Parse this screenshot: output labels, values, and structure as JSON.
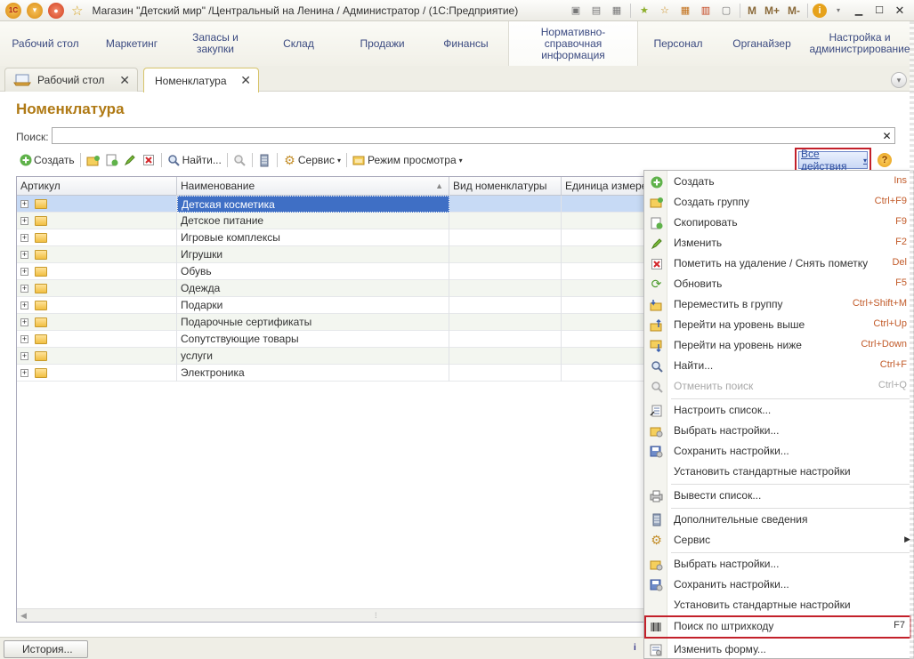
{
  "window": {
    "title": "Магазин \"Детский мир\" /Центральный на Ленина / Администратор /  (1С:Предприятие)",
    "logo_text": "1С",
    "right_buttons": [
      "M",
      "M+",
      "M-"
    ]
  },
  "sections": [
    {
      "label": "Рабочий стол",
      "active": false
    },
    {
      "label": "Маркетинг",
      "active": false
    },
    {
      "label": "Запасы и закупки",
      "active": false
    },
    {
      "label": "Склад",
      "active": false
    },
    {
      "label": "Продажи",
      "active": false
    },
    {
      "label": "Финансы",
      "active": false
    },
    {
      "label": "Нормативно-справочная информация",
      "active": true
    },
    {
      "label": "Персонал",
      "active": false
    },
    {
      "label": "Органайзер",
      "active": false
    },
    {
      "label": "Настройка и администрирование",
      "active": false
    }
  ],
  "tabs": [
    {
      "label": "Рабочий стол",
      "active": false
    },
    {
      "label": "Номенклатура",
      "active": true
    }
  ],
  "form": {
    "title": "Номенклатура",
    "search_label": "Поиск:",
    "search_value": ""
  },
  "toolbar": {
    "create": "Создать",
    "find": "Найти...",
    "service": "Сервис",
    "view_mode": "Режим просмотра",
    "all_actions": "Все действия",
    "help": "?"
  },
  "grid": {
    "columns": [
      "Артикул",
      "Наименование",
      "Вид номенклатуры",
      "Единица измерения"
    ],
    "rows": [
      {
        "name": "Детская косметика",
        "selected": true
      },
      {
        "name": "Детское питание",
        "selected": false
      },
      {
        "name": "Игровые комплексы",
        "selected": false
      },
      {
        "name": "Игрушки",
        "selected": false
      },
      {
        "name": "Обувь",
        "selected": false
      },
      {
        "name": "Одежда",
        "selected": false
      },
      {
        "name": "Подарки",
        "selected": false
      },
      {
        "name": "Подарочные сертификаты",
        "selected": false
      },
      {
        "name": "Сопутствующие товары",
        "selected": false
      },
      {
        "name": "услуги",
        "selected": false
      },
      {
        "name": "Электроника",
        "selected": false
      }
    ]
  },
  "menu": {
    "items": [
      {
        "label": "Создать",
        "shortcut": "Ins",
        "icon": "create-icon"
      },
      {
        "label": "Создать группу",
        "shortcut": "Ctrl+F9",
        "icon": "create-group-icon"
      },
      {
        "label": "Скопировать",
        "shortcut": "F9",
        "icon": "copy-icon"
      },
      {
        "label": "Изменить",
        "shortcut": "F2",
        "icon": "edit-icon"
      },
      {
        "label": "Пометить на удаление / Снять пометку",
        "shortcut": "Del",
        "icon": "delete-mark-icon"
      },
      {
        "label": "Обновить",
        "shortcut": "F5",
        "icon": "refresh-icon"
      },
      {
        "label": "Переместить в группу",
        "shortcut": "Ctrl+Shift+M",
        "icon": "move-to-group-icon"
      },
      {
        "label": "Перейти на уровень выше",
        "shortcut": "Ctrl+Up",
        "icon": "level-up-icon"
      },
      {
        "label": "Перейти на уровень ниже",
        "shortcut": "Ctrl+Down",
        "icon": "level-down-icon"
      },
      {
        "label": "Найти...",
        "shortcut": "Ctrl+F",
        "icon": "find-icon"
      },
      {
        "label": "Отменить поиск",
        "shortcut": "Ctrl+Q",
        "icon": "cancel-search-icon",
        "disabled": true
      },
      {
        "label": "Настроить список...",
        "shortcut": "",
        "icon": "configure-list-icon"
      },
      {
        "label": "Выбрать настройки...",
        "shortcut": "",
        "icon": "load-settings-icon"
      },
      {
        "label": "Сохранить настройки...",
        "shortcut": "",
        "icon": "save-settings-icon"
      },
      {
        "label": "Установить стандартные настройки",
        "shortcut": "",
        "icon": ""
      },
      {
        "label": "Вывести список...",
        "shortcut": "",
        "icon": "print-list-icon"
      },
      {
        "label": "Дополнительные сведения",
        "shortcut": "",
        "icon": "extra-info-icon"
      },
      {
        "label": "Сервис",
        "shortcut": "",
        "icon": "service-icon",
        "submenu": true
      },
      {
        "label": "Выбрать настройки...",
        "shortcut": "",
        "icon": "load-settings-icon"
      },
      {
        "label": "Сохранить настройки...",
        "shortcut": "",
        "icon": "save-settings-icon"
      },
      {
        "label": "Установить стандартные настройки",
        "shortcut": "",
        "icon": ""
      },
      {
        "label": "Поиск по штрихкоду",
        "shortcut": "F7",
        "icon": "barcode-icon",
        "boxed": true
      },
      {
        "label": "Изменить форму...",
        "shortcut": "",
        "icon": "edit-form-icon"
      }
    ]
  },
  "statusbar": {
    "history": "История..."
  },
  "colors": {
    "accent_title": "#b07a15",
    "selection": "#3f6fc5",
    "highlight_box": "#c3202a",
    "shortcut": "#c25b2a"
  }
}
